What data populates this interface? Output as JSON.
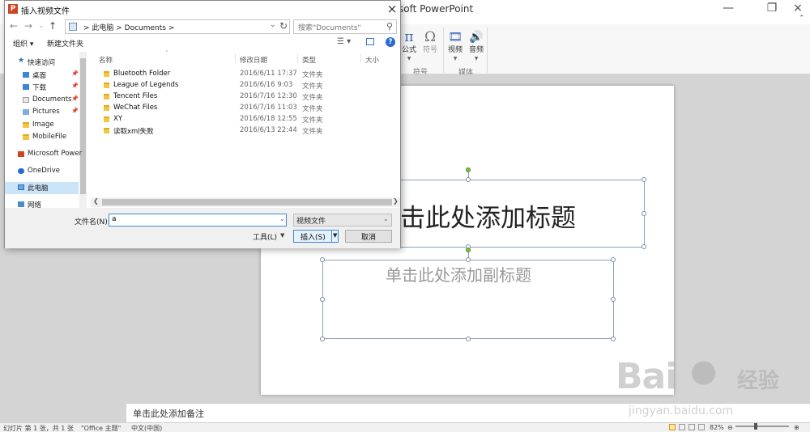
{
  "ppt": {
    "title": "rosoft PowerPoint",
    "ribbon": {
      "equation": {
        "icon": "π",
        "label": "公式"
      },
      "symbol": {
        "icon": "Ω",
        "label": "符号"
      },
      "video": {
        "icon": "🎞",
        "label": "视频"
      },
      "audio": {
        "icon": "🔊",
        "label": "音频"
      },
      "group_symbols": "符号",
      "group_media": "媒体"
    },
    "slide": {
      "title_placeholder": "击此处添加标题",
      "subtitle_placeholder": "单击此处添加副标题"
    },
    "notes_placeholder": "单击此处添加备注",
    "status": {
      "slide_info": "幻灯片 第 1 张，共 1 张",
      "theme": "\"Office 主题\"",
      "language": "中文(中国)",
      "zoom": "82%"
    }
  },
  "watermark": {
    "logo": "Bai",
    "logo2": "经验",
    "url": "jingyan.baidu.com"
  },
  "dialog": {
    "app_icon": "P",
    "title": "插入视频文件",
    "close": "×",
    "breadcrumb": ">  此电脑  >  Documents  >",
    "search_placeholder": "搜索\"Documents\"",
    "toolbar": {
      "organize": "组织 ▾",
      "new_folder": "新建文件夹",
      "help": "?"
    },
    "nav_items": [
      {
        "label": "快速访问",
        "pinned": false
      },
      {
        "label": "桌面",
        "pinned": true
      },
      {
        "label": "下载",
        "pinned": true
      },
      {
        "label": "Documents",
        "pinned": true
      },
      {
        "label": "Pictures",
        "pinned": true
      },
      {
        "label": "Image",
        "pinned": false
      },
      {
        "label": "MobileFile",
        "pinned": false
      },
      {
        "label": "Microsoft Power",
        "pinned": false
      },
      {
        "label": "OneDrive",
        "pinned": false
      },
      {
        "label": "此电脑",
        "pinned": false
      },
      {
        "label": "网络",
        "pinned": false
      }
    ],
    "columns": {
      "name": "名称",
      "date": "修改日期",
      "type": "类型",
      "size": "大小"
    },
    "files": [
      {
        "name": "Bluetooth Folder",
        "date": "2016/6/11 17:37",
        "type": "文件夹"
      },
      {
        "name": "League of Legends",
        "date": "2016/6/16 9:03",
        "type": "文件夹"
      },
      {
        "name": "Tencent Files",
        "date": "2016/7/16 12:30",
        "type": "文件夹"
      },
      {
        "name": "WeChat Files",
        "date": "2016/7/16 11:03",
        "type": "文件夹"
      },
      {
        "name": "XY",
        "date": "2016/6/18 12:55",
        "type": "文件夹"
      },
      {
        "name": "读取xml失败",
        "date": "2016/6/13 22:44",
        "type": "文件夹"
      }
    ],
    "filename_label": "文件名(N):",
    "filename_value": "a",
    "filetype_value": "视频文件",
    "tools_label": "工具(L)",
    "insert_label": "插入(S)",
    "cancel_label": "取消"
  }
}
